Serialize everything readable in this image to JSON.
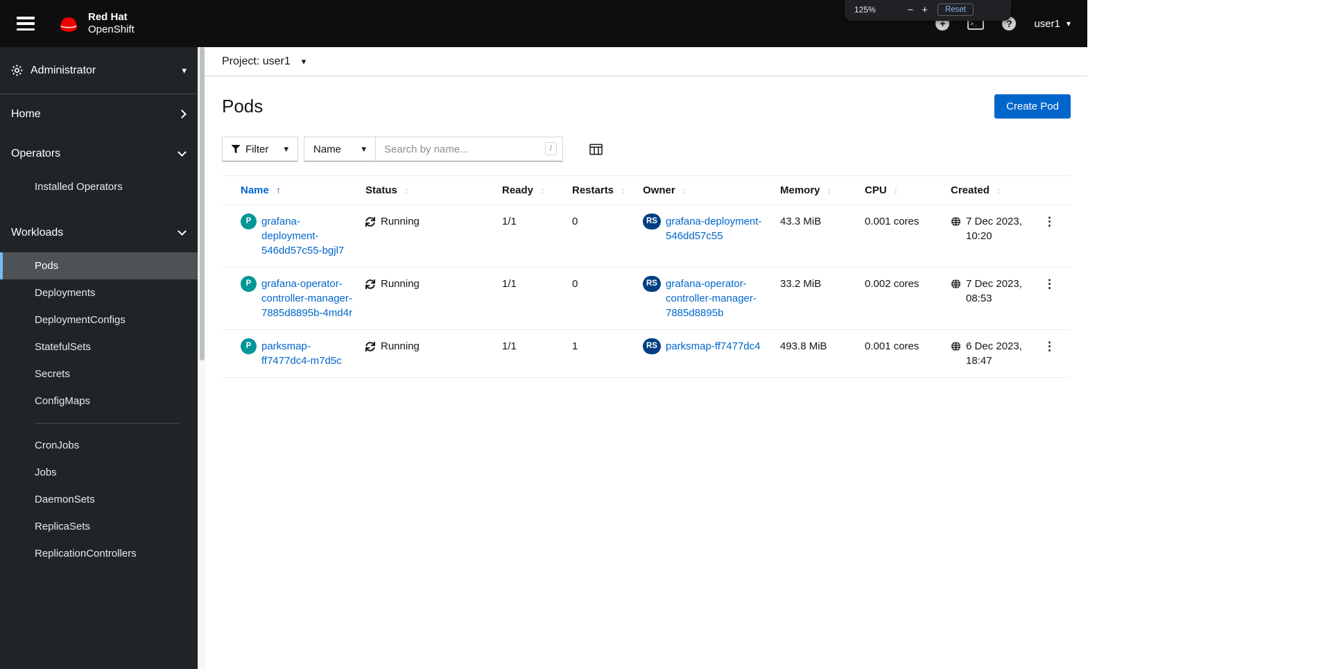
{
  "colors": {
    "accent": "#0066cc",
    "masthead_bg": "#0e0e0e",
    "sidebar_bg": "#212427",
    "selected_nav_border": "#73bcf7",
    "pod_badge": "#009596",
    "replicaset_badge": "#004080",
    "redhat_red": "#ee0000"
  },
  "glyphs": {
    "caret_down": "▾",
    "kebab": "⋮",
    "sort_both": "↕",
    "sort_asc": "↑"
  },
  "masthead": {
    "brand_line1": "Red Hat",
    "brand_line2": "OpenShift",
    "user_menu_label": "user1",
    "icons": {
      "quick_create_glyph": "+",
      "terminal_glyph": ">_",
      "help_glyph": "?"
    },
    "zoom_popup": {
      "level": "125%",
      "minus_label": "−",
      "plus_label": "+",
      "reset_label": "Reset"
    }
  },
  "sidebar": {
    "perspective_label": "Administrator",
    "items": [
      {
        "label": "Home"
      },
      {
        "label": "Operators",
        "children": [
          "Installed Operators"
        ]
      },
      {
        "label": "Workloads",
        "selected": "Pods",
        "children": [
          "Pods",
          "Deployments",
          "DeploymentConfigs",
          "StatefulSets",
          "Secrets",
          "ConfigMaps",
          "CronJobs",
          "Jobs",
          "DaemonSets",
          "ReplicaSets",
          "ReplicationControllers"
        ]
      }
    ]
  },
  "project_bar": {
    "label": "Project: user1"
  },
  "page": {
    "title": "Pods",
    "create_button_label": "Create Pod"
  },
  "toolbar": {
    "filter_label": "Filter",
    "attribute_label": "Name",
    "search_placeholder": "Search by name...",
    "search_shortcut": "/"
  },
  "table": {
    "columns": [
      "Name",
      "Status",
      "Ready",
      "Restarts",
      "Owner",
      "Memory",
      "CPU",
      "Created"
    ],
    "rows": [
      {
        "badge": "P",
        "name": "grafana-deployment-546dd57c55-bgjl7",
        "status": "Running",
        "ready": "1/1",
        "restarts": "0",
        "owner_badge": "RS",
        "owner": "grafana-deployment-546dd57c55",
        "memory": "43.3 MiB",
        "cpu": "0.001 cores",
        "created": "7 Dec 2023, 10:20"
      },
      {
        "badge": "P",
        "name": "grafana-operator-controller-manager-7885d8895b-4md4r",
        "status": "Running",
        "ready": "1/1",
        "restarts": "0",
        "owner_badge": "RS",
        "owner": "grafana-operator-controller-manager-7885d8895b",
        "memory": "33.2 MiB",
        "cpu": "0.002 cores",
        "created": "7 Dec 2023, 08:53"
      },
      {
        "badge": "P",
        "name": "parksmap-ff7477dc4-m7d5c",
        "status": "Running",
        "ready": "1/1",
        "restarts": "1",
        "owner_badge": "RS",
        "owner": "parksmap-ff7477dc4",
        "memory": "493.8 MiB",
        "cpu": "0.001 cores",
        "created": "6 Dec 2023, 18:47"
      }
    ]
  }
}
